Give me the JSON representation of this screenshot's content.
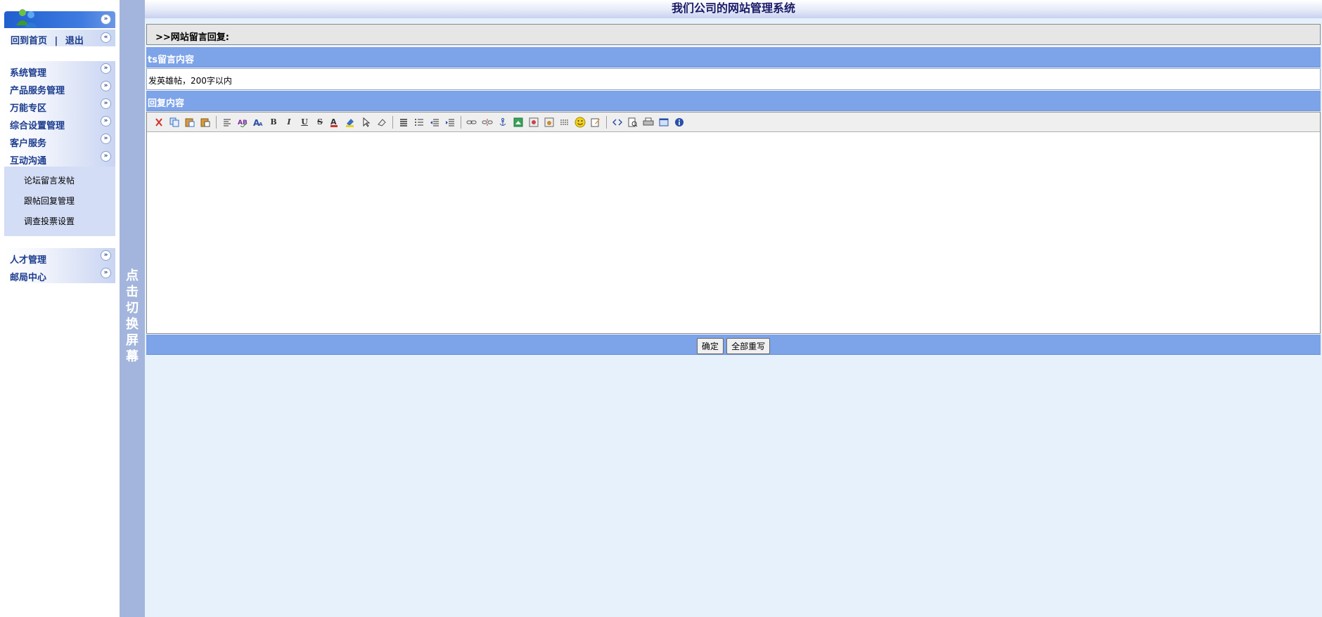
{
  "sidebar": {
    "top_links": {
      "home": "回到首页",
      "separator": "|",
      "logout": "退出"
    },
    "menu_items": [
      {
        "label": "系统管理"
      },
      {
        "label": "产品服务管理"
      },
      {
        "label": "万能专区"
      },
      {
        "label": "综合设置管理"
      },
      {
        "label": "客户服务"
      },
      {
        "label": "互动沟通"
      }
    ],
    "submenu_items": [
      {
        "label": "论坛留言发帖"
      },
      {
        "label": "跟帖回复管理"
      },
      {
        "label": "调查投票设置"
      }
    ],
    "menu_items_2": [
      {
        "label": "人才管理"
      },
      {
        "label": "邮局中心"
      }
    ]
  },
  "switch_bar": {
    "text": "点击切换屏幕"
  },
  "header": {
    "title": "我们公司的网站管理系统"
  },
  "breadcrumb": {
    "text": ">>网站留言回复:"
  },
  "message_section": {
    "title": "ts留言内容",
    "content": "发英雄帖，200字以内"
  },
  "reply_section": {
    "title": "回复内容"
  },
  "editor": {
    "toolbar_icons": [
      "cut-icon",
      "copy-icon",
      "paste-icon",
      "paste-text-icon",
      "sep",
      "paragraph-icon",
      "spellcheck-icon",
      "font-size-icon",
      "bold-icon",
      "italic-icon",
      "underline-icon",
      "strikethrough-icon",
      "font-color-icon",
      "highlight-icon",
      "select-icon",
      "eraser-icon",
      "sep",
      "align-icon",
      "unordered-list-icon",
      "outdent-icon",
      "indent-icon",
      "sep",
      "link-icon",
      "unlink-icon",
      "anchor-icon",
      "image-icon",
      "flash-icon",
      "media-icon",
      "horizontal-rule-icon",
      "smiley-icon",
      "edit-icon",
      "sep",
      "source-icon",
      "preview-icon",
      "print-icon",
      "fullscreen-icon",
      "about-icon"
    ]
  },
  "buttons": {
    "submit": "确定",
    "reset": "全部重写"
  }
}
